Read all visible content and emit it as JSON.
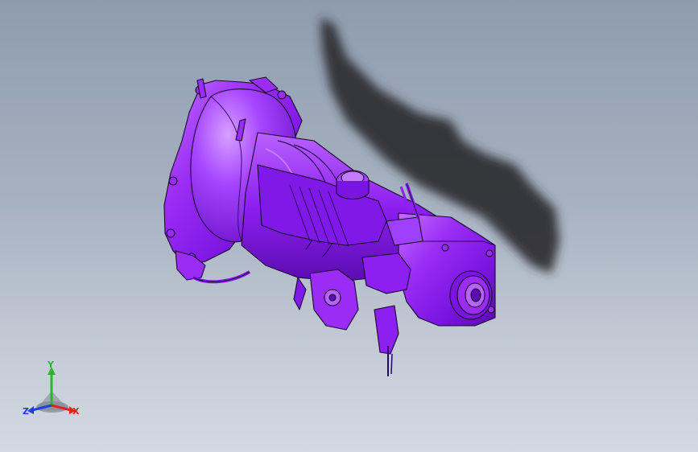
{
  "triad": {
    "x_label": "X",
    "y_label": "Y",
    "z_label": "Z"
  },
  "colors": {
    "background_top": "#8e9cae",
    "background_bottom": "#d3d9e2",
    "model": "#8d1ff0",
    "model_edges": "#1a0830",
    "shadow": "#2b2d32",
    "axis_x": "#e0251b",
    "axis_y": "#2bb52b",
    "axis_z": "#1f3de0"
  },
  "model": {
    "name_icon": "transmission-3d-model"
  }
}
